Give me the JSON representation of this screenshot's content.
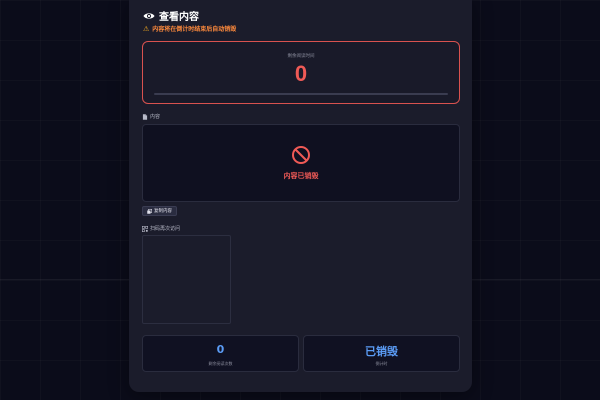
{
  "header": {
    "title": "查看内容",
    "icon": "eye-icon"
  },
  "warning": {
    "text": "内容将在倒计时结束后自动销毁",
    "icon": "warning-icon"
  },
  "timer": {
    "label": "剩余阅读时间",
    "value": "0",
    "progress": 0
  },
  "content_section": {
    "label": "内容",
    "status_text": "内容已销毁",
    "icon": "ban-icon"
  },
  "copy_button": {
    "label": "复制内容"
  },
  "qr_section": {
    "label": "扫码再次访问"
  },
  "stats": [
    {
      "value": "0",
      "label": "剩余阅读次数"
    },
    {
      "value": "已销毁",
      "label": "倒计时"
    }
  ],
  "colors": {
    "danger": "#ef5a56",
    "warning": "#ff8a3c",
    "accent": "#5b9cf5",
    "card_bg": "#1b1c2b",
    "page_bg": "#0b0c1a"
  }
}
